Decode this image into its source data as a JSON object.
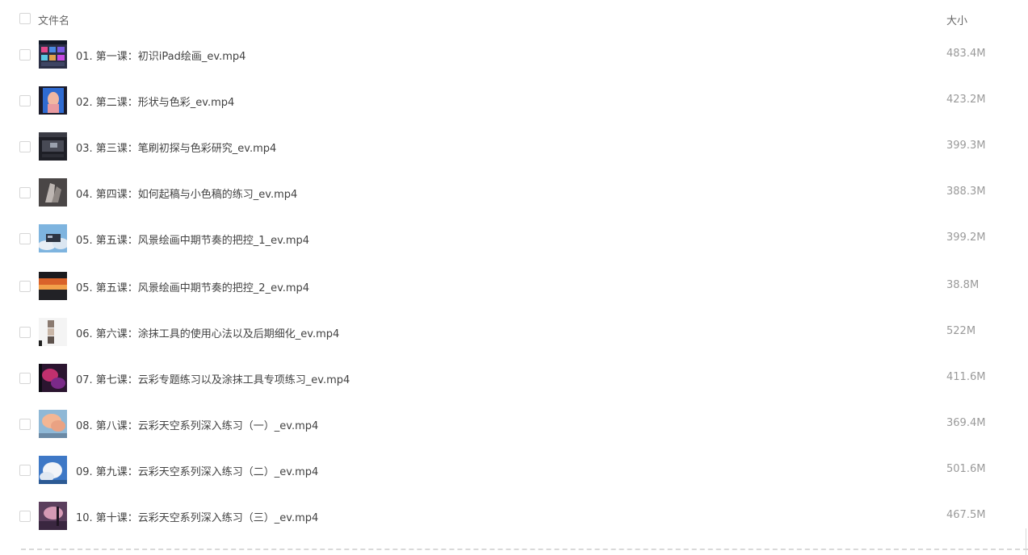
{
  "header": {
    "name_label": "文件名",
    "size_label": "大小"
  },
  "files": [
    {
      "name": "01. 第一课：初识iPad绘画_ev.mp4",
      "size": "483.4M",
      "thumb": "thumb-ui-dark"
    },
    {
      "name": "02. 第二课：形状与色彩_ev.mp4",
      "size": "423.2M",
      "thumb": "thumb-portrait-blue"
    },
    {
      "name": "03. 第三课：笔刷初探与色彩研究_ev.mp4",
      "size": "399.3M",
      "thumb": "thumb-ui-dark"
    },
    {
      "name": "04. 第四课：如何起稿与小色稿的练习_ev.mp4",
      "size": "388.3M",
      "thumb": "thumb-hands-gray"
    },
    {
      "name": "05. 第五课：风景绘画中期节奏的把控_1_ev.mp4",
      "size": "399.2M",
      "thumb": "thumb-sky-ui"
    },
    {
      "name": "05. 第五课：风景绘画中期节奏的把控_2_ev.mp4",
      "size": "38.8M",
      "thumb": "thumb-sunset"
    },
    {
      "name": "06. 第六课：涂抹工具的使用心法以及后期细化_ev.mp4",
      "size": "522M",
      "thumb": "thumb-palette-white"
    },
    {
      "name": "07. 第七课：云彩专题练习以及涂抹工具专项练习_ev.mp4",
      "size": "411.6M",
      "thumb": "thumb-pink-night"
    },
    {
      "name": "08. 第八课：云彩天空系列深入练习（一）_ev.mp4",
      "size": "369.4M",
      "thumb": "thumb-clouds-peach"
    },
    {
      "name": "09. 第九课：云彩天空系列深入练习（二）_ev.mp4",
      "size": "501.6M",
      "thumb": "thumb-clouds-blue"
    },
    {
      "name": "10. 第十课：云彩天空系列深入练习（三）_ev.mp4",
      "size": "467.5M",
      "thumb": "thumb-pink-dusk"
    }
  ]
}
